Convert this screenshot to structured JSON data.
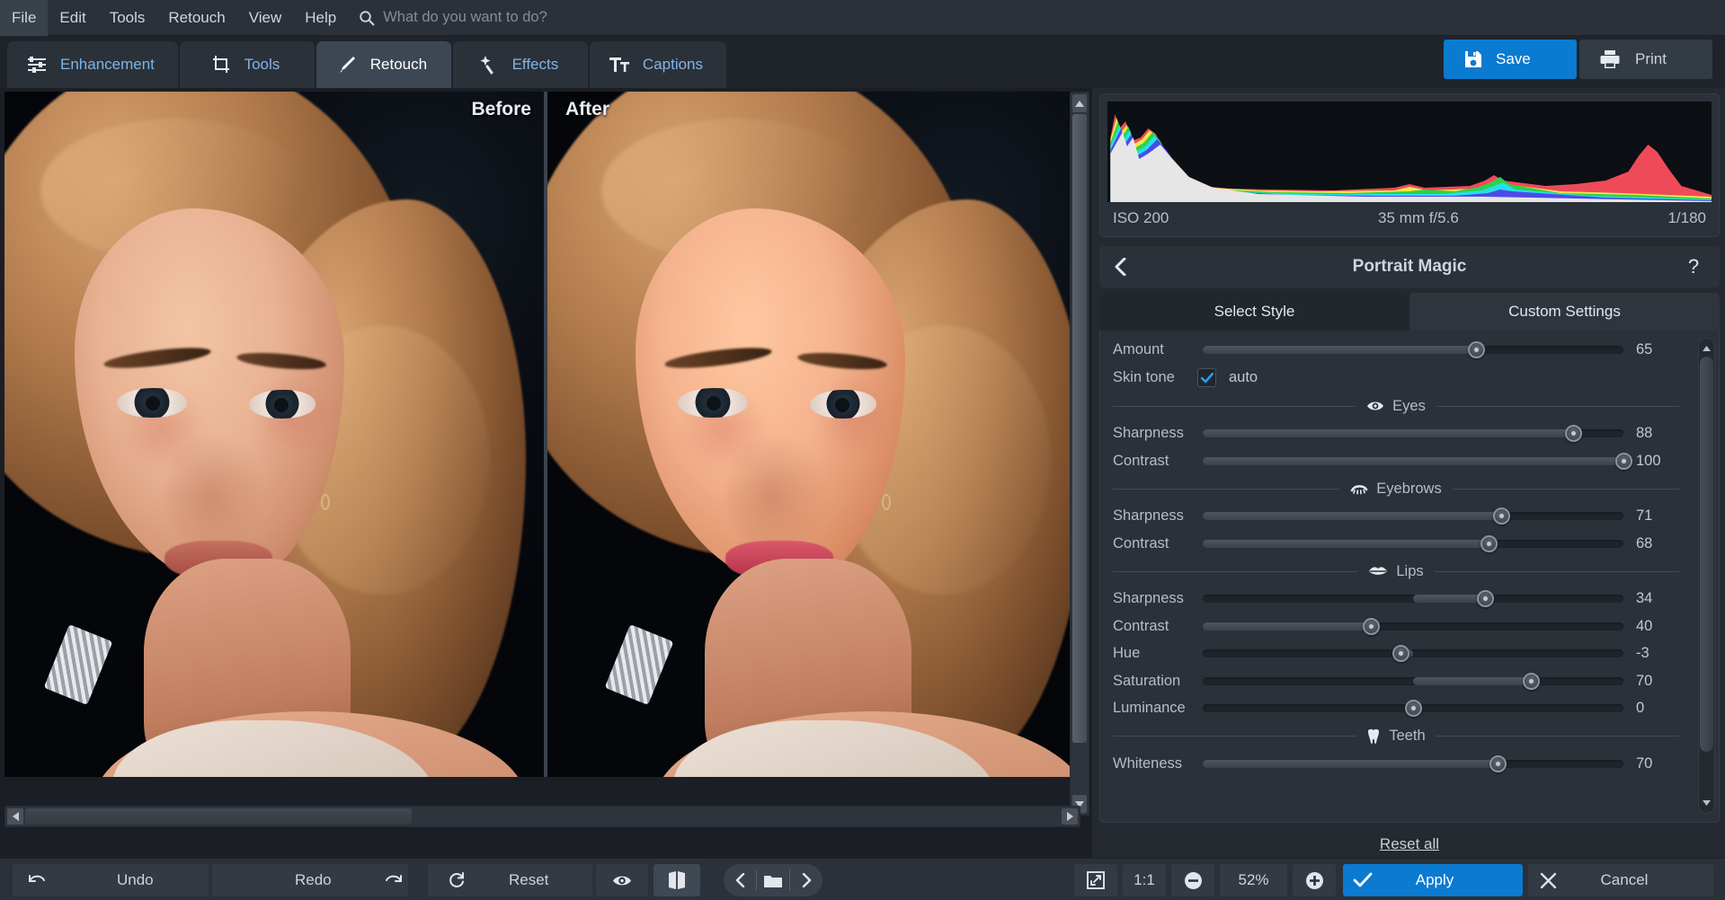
{
  "menu": {
    "items": [
      {
        "label": "File"
      },
      {
        "label": "Edit"
      },
      {
        "label": "Tools"
      },
      {
        "label": "Retouch"
      },
      {
        "label": "View"
      },
      {
        "label": "Help"
      }
    ],
    "search_icon": "search-icon",
    "search_placeholder": "What do you want to do?"
  },
  "tabs": [
    {
      "label": "Enhancement",
      "icon": "sliders-icon",
      "active": false
    },
    {
      "label": "Tools",
      "icon": "crop-icon",
      "active": false
    },
    {
      "label": "Retouch",
      "icon": "brush-icon",
      "active": true
    },
    {
      "label": "Effects",
      "icon": "magic-wand-icon",
      "active": false
    },
    {
      "label": "Captions",
      "icon": "text-icon",
      "active": false
    }
  ],
  "topbar": {
    "save_label": "Save",
    "save_icon": "floppy-disk-icon",
    "print_label": "Print",
    "print_icon": "printer-icon",
    "accent_color": "#0b7ad1"
  },
  "canvas": {
    "before_label": "Before",
    "after_label": "After"
  },
  "histogram": {
    "iso": "ISO 200",
    "lens": "35 mm f/5.6",
    "shutter": "1/180"
  },
  "panel": {
    "back_icon": "chevron-left-icon",
    "title": "Portrait Magic",
    "help_icon": "question-mark-icon",
    "tabs": [
      {
        "label": "Select Style",
        "active": false
      },
      {
        "label": "Custom Settings",
        "active": true
      }
    ],
    "reset_all": "Reset all",
    "rows": [
      {
        "type": "slider",
        "label": "Amount",
        "value": "65",
        "pct": 65,
        "min": 0,
        "max": 100
      },
      {
        "type": "checkbox",
        "label": "Skin tone",
        "checkbox_label": "auto",
        "checked": true
      },
      {
        "type": "section",
        "label": "Eyes",
        "icon": "eye-icon"
      },
      {
        "type": "slider",
        "label": "Sharpness",
        "value": "88",
        "pct": 88,
        "min": 0,
        "max": 100
      },
      {
        "type": "slider",
        "label": "Contrast",
        "value": "100",
        "pct": 100,
        "min": 0,
        "max": 100
      },
      {
        "type": "section",
        "label": "Eyebrows",
        "icon": "eyebrow-icon"
      },
      {
        "type": "slider",
        "label": "Sharpness",
        "value": "71",
        "pct": 71,
        "min": 0,
        "max": 100
      },
      {
        "type": "slider",
        "label": "Contrast",
        "value": "68",
        "pct": 68,
        "min": 0,
        "max": 100
      },
      {
        "type": "section",
        "label": "Lips",
        "icon": "lips-icon"
      },
      {
        "type": "slider",
        "label": "Sharpness",
        "value": "34",
        "pct": 67,
        "min": 0,
        "max": 100
      },
      {
        "type": "slider",
        "label": "Contrast",
        "value": "40",
        "pct": 40,
        "min": 0,
        "max": 100
      },
      {
        "type": "slider",
        "label": "Hue",
        "value": "-3",
        "pct": 47,
        "min": -100,
        "max": 100
      },
      {
        "type": "slider",
        "label": "Saturation",
        "value": "70",
        "pct": 78,
        "min": 0,
        "max": 100
      },
      {
        "type": "slider",
        "label": "Luminance",
        "value": "0",
        "pct": 50,
        "min": -100,
        "max": 100
      },
      {
        "type": "section",
        "label": "Teeth",
        "icon": "tooth-icon"
      },
      {
        "type": "slider",
        "label": "Whiteness",
        "value": "70",
        "pct": 70,
        "min": 0,
        "max": 100
      }
    ]
  },
  "bottombar": {
    "undo_label": "Undo",
    "undo_icon": "undo-arrow-icon",
    "redo_label": "Redo",
    "redo_icon": "redo-arrow-icon",
    "reset_label": "Reset",
    "reset_icon": "reset-circle-icon",
    "preview_icon": "eye-icon",
    "compare_icon": "split-view-icon",
    "prev_icon": "chevron-left-icon",
    "folder_icon": "folder-icon",
    "next_icon": "chevron-right-icon",
    "fit_icon": "fit-to-screen-icon",
    "oneone_label": "1:1",
    "zoom_out_icon": "minus-circle-icon",
    "zoom_value": "52%",
    "zoom_in_icon": "plus-circle-icon",
    "apply_label": "Apply",
    "apply_icon": "checkmark-icon",
    "cancel_label": "Cancel",
    "cancel_icon": "close-x-icon"
  }
}
